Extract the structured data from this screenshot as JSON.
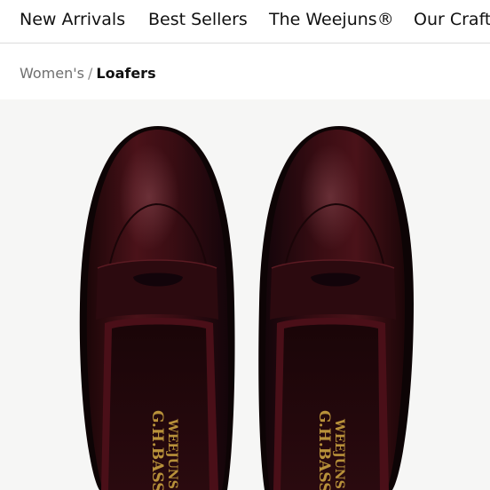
{
  "nav": {
    "items": [
      {
        "label": "New Arrivals"
      },
      {
        "label": "Best Sellers"
      },
      {
        "label": "The Weejuns®"
      },
      {
        "label": "Our Craft"
      }
    ]
  },
  "breadcrumb": {
    "parent": "Women's",
    "separator": "/",
    "current": "Loafers"
  },
  "product": {
    "image_icon": "penny-loafers-image",
    "brand_stamp_line1": "G.H.BASS",
    "brand_stamp_line2": "WEEJUNS",
    "leather_color": "#3a0f14",
    "background_color": "#f6f6f5"
  }
}
